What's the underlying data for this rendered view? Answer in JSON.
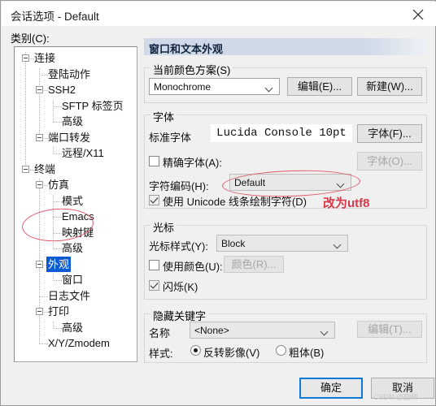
{
  "window": {
    "title": "会话选项 - Default",
    "close_icon": "close-icon"
  },
  "category": {
    "label": "类别(C):",
    "tree": [
      {
        "label": "连接",
        "level": 0,
        "expander": true,
        "selected": false
      },
      {
        "label": "登陆动作",
        "level": 1,
        "expander": false,
        "selected": false
      },
      {
        "label": "SSH2",
        "level": 1,
        "expander": true,
        "selected": false
      },
      {
        "label": "SFTP 标签页",
        "level": 2,
        "expander": false,
        "selected": false
      },
      {
        "label": "高级",
        "level": 2,
        "expander": false,
        "selected": false
      },
      {
        "label": "端口转发",
        "level": 1,
        "expander": true,
        "selected": false
      },
      {
        "label": "远程/X11",
        "level": 2,
        "expander": false,
        "selected": false
      },
      {
        "label": "终端",
        "level": 0,
        "expander": true,
        "selected": false
      },
      {
        "label": "仿真",
        "level": 1,
        "expander": true,
        "selected": false
      },
      {
        "label": "模式",
        "level": 2,
        "expander": false,
        "selected": false
      },
      {
        "label": "Emacs",
        "level": 2,
        "expander": false,
        "selected": false
      },
      {
        "label": "映射键",
        "level": 2,
        "expander": false,
        "selected": false
      },
      {
        "label": "高级",
        "level": 2,
        "expander": false,
        "selected": false
      },
      {
        "label": "外观",
        "level": 1,
        "expander": true,
        "selected": true
      },
      {
        "label": "窗口",
        "level": 2,
        "expander": false,
        "selected": false
      },
      {
        "label": "日志文件",
        "level": 1,
        "expander": false,
        "selected": false
      },
      {
        "label": "打印",
        "level": 1,
        "expander": true,
        "selected": false
      },
      {
        "label": "高级",
        "level": 2,
        "expander": false,
        "selected": false
      },
      {
        "label": "X/Y/Zmodem",
        "level": 1,
        "expander": false,
        "selected": false
      }
    ]
  },
  "panel": {
    "header": "窗口和文本外观",
    "color_scheme": {
      "group_label": "当前颜色方案(S)",
      "value": "Monochrome",
      "edit_button": "编辑(E)...",
      "new_button": "新建(W)..."
    },
    "font": {
      "group_label": "字体",
      "normal_font_label": "标准字体",
      "normal_font_value": "Lucida Console 10pt",
      "font_button": "字体(F)...",
      "exact_font_label": "精确字体(A):",
      "exact_font_checked": false,
      "exact_font_button": "字体(O)...",
      "exact_font_button_disabled": true,
      "encoding_label": "字符编码(H):",
      "encoding_value": "Default",
      "unicode_line_label": "使用 Unicode 线条绘制字符(D)",
      "unicode_line_checked": true
    },
    "cursor": {
      "group_label": "光标",
      "style_label": "光标样式(Y):",
      "style_value": "Block",
      "use_color_label": "使用颜色(U):",
      "use_color_checked": false,
      "color_button": "颜色(R)...",
      "color_button_disabled": true,
      "blink_label": "闪烁(K)",
      "blink_checked": true
    },
    "keyword": {
      "group_label": "隐藏关键字",
      "name_label": "名称",
      "name_value": "<None>",
      "edit_button": "编辑(T)...",
      "edit_button_disabled": true,
      "style_label": "样式:",
      "radio_reverse": "反转影像(V)",
      "radio_reverse_selected": true,
      "radio_bold": "粗体(B)",
      "radio_bold_selected": false
    }
  },
  "footer": {
    "ok_button": "确定",
    "cancel_button": "取消"
  },
  "annotations": {
    "utf8_note": "改为utf8",
    "accent_red": "#d8394a",
    "ellipse_color": "#e0596b",
    "selection_blue": "#0a5bd3"
  },
  "watermark": "CSDN @励树"
}
